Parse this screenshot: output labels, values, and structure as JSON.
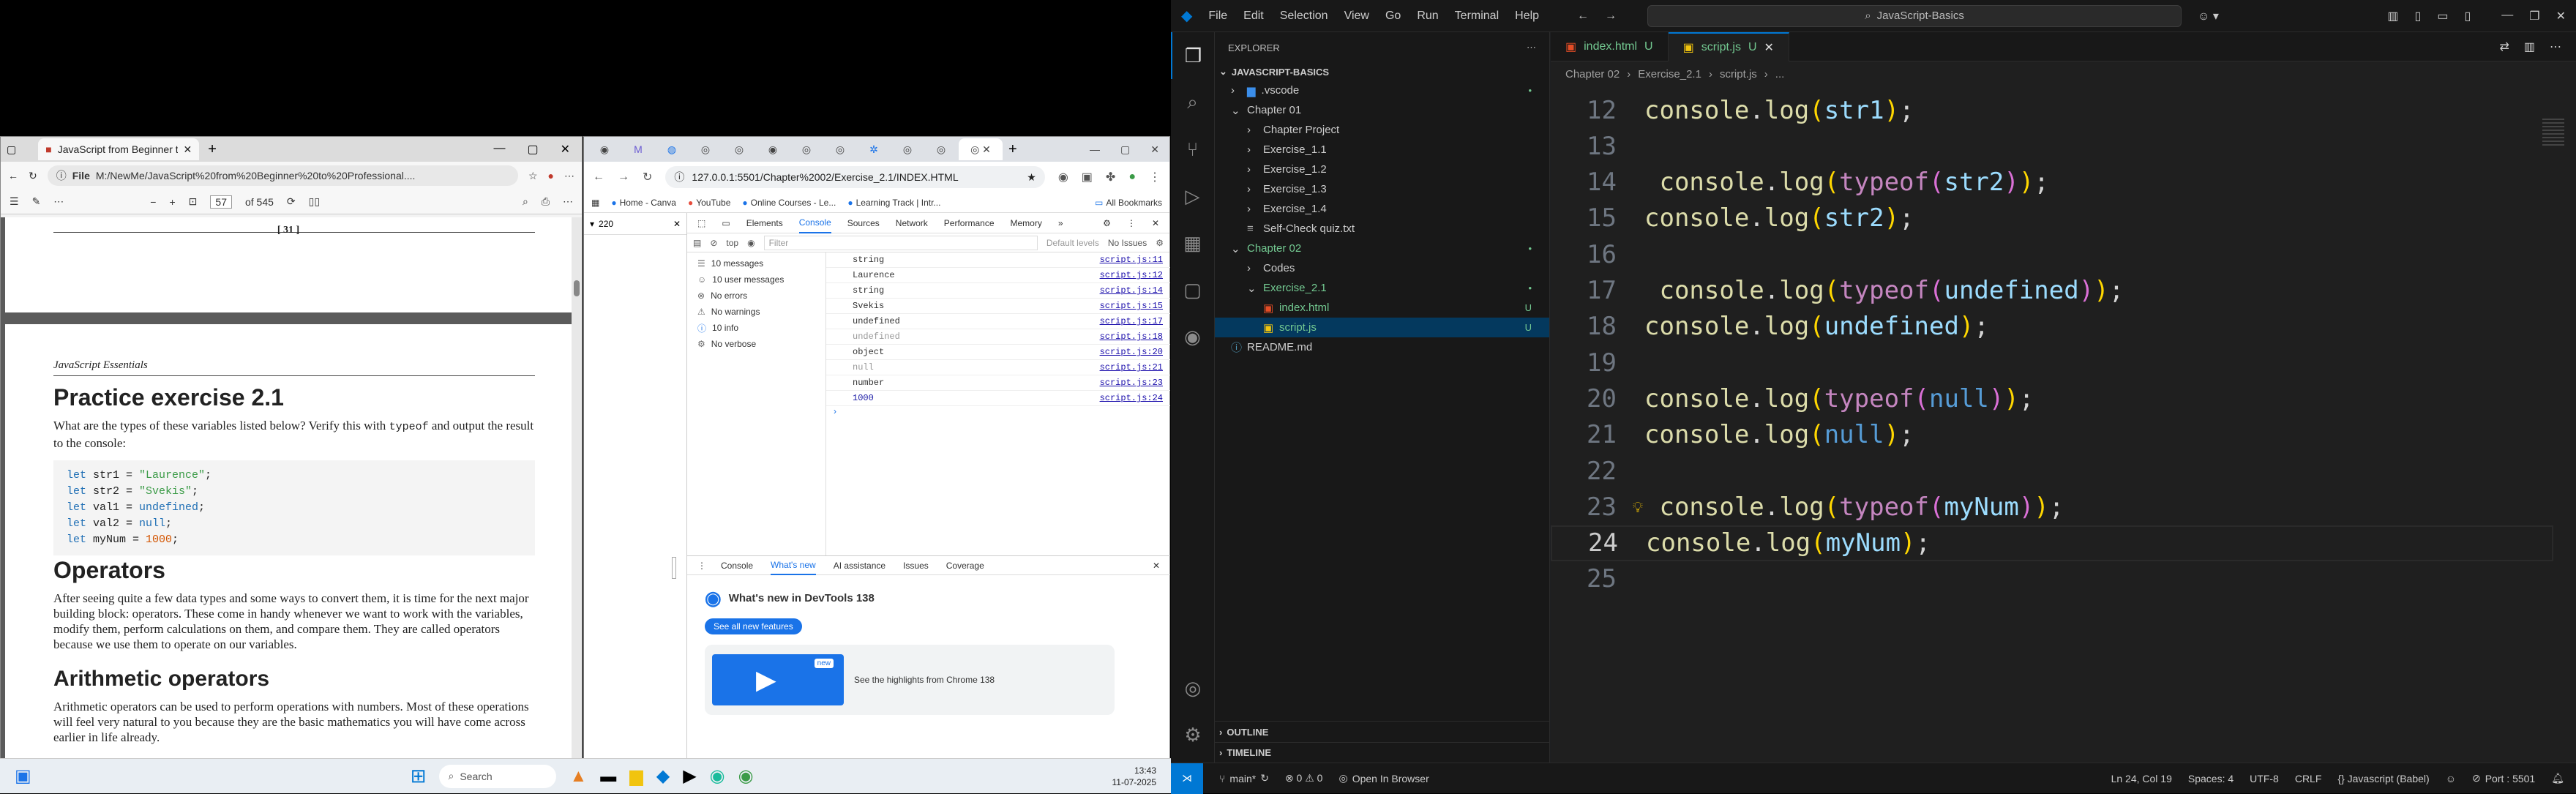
{
  "pdf": {
    "tab_title": "JavaScript from Beginner to Profe",
    "address": "M:/NewMe/JavaScript%20from%20Beginner%20to%20Professional....",
    "file_label": "File",
    "page_input": "57",
    "page_total": "of 545",
    "page_number_header": "[ 31 ]",
    "running_head": "JavaScript Essentials",
    "section1_title": "Practice exercise 2.1",
    "section1_text_a": "What are the types of these variables listed below? Verify this with",
    "section1_text_code": "typeof",
    "section1_text_b": "and",
    "section1_text_c": "output the result to the console:",
    "code_lines": [
      {
        "kw": "let",
        "name": " str1 = ",
        "val": "\"Laurence\"",
        "cls": "str"
      },
      {
        "kw": "let",
        "name": " str2 = ",
        "val": "\"Svekis\"",
        "cls": "str"
      },
      {
        "kw": "let",
        "name": " val1 = ",
        "val": "undefined",
        "cls": "kw"
      },
      {
        "kw": "let",
        "name": " val2 = ",
        "val": "null",
        "cls": "kw"
      },
      {
        "kw": "let",
        "name": " myNum = ",
        "val": "1000",
        "cls": "num"
      }
    ],
    "section2_title": "Operators",
    "section2_text": "After seeing quite a few data types and some ways to convert them, it is time for the next major building block: operators. These come in handy whenever we want to work with the variables, modify them, perform calculations on them, and compare them. They are called operators because we use them to operate on our variables.",
    "section3_title": "Arithmetic operators",
    "section3_text": "Arithmetic operators can be used to perform operations with numbers. Most of these operations will feel very natural to you because they are the basic mathematics you will have come across earlier in life already."
  },
  "chrome": {
    "url": "127.0.0.1:5501/Chapter%2002/Exercise_2.1/INDEX.HTML",
    "bookmarks": [
      "Home - Canva",
      "YouTube",
      "Online Courses - Le...",
      "Learning Track | Intr...",
      "All Bookmarks"
    ],
    "zoom_value": "220",
    "devtools_tabs": [
      "Elements",
      "Console",
      "Sources",
      "Network",
      "Performance",
      "Memory"
    ],
    "context": "top",
    "filter_placeholder": "Filter",
    "levels": "Default levels",
    "issues": "No Issues",
    "sidebar_items": [
      "10 messages",
      "10 user messages",
      "No errors",
      "No warnings",
      "10 info",
      "No verbose"
    ],
    "console_lines": [
      {
        "text": "string",
        "src": "script.js:11",
        "dim": false
      },
      {
        "text": "Laurence",
        "src": "script.js:12",
        "dim": false
      },
      {
        "text": "string",
        "src": "script.js:14",
        "dim": false
      },
      {
        "text": "Svekis",
        "src": "script.js:15",
        "dim": false
      },
      {
        "text": "undefined",
        "src": "script.js:17",
        "dim": false
      },
      {
        "text": "undefined",
        "src": "script.js:18",
        "dim": true
      },
      {
        "text": "object",
        "src": "script.js:20",
        "dim": false
      },
      {
        "text": "null",
        "src": "script.js:21",
        "dim": true
      },
      {
        "text": "number",
        "src": "script.js:23",
        "dim": false
      },
      {
        "text": "1000",
        "src": "script.js:24",
        "dim": false
      }
    ],
    "prompt": "›",
    "drawer_tabs": [
      "Console",
      "What's new",
      "AI assistance",
      "Issues",
      "Coverage"
    ],
    "whats_new_title": "What's new in DevTools 138",
    "see_all": "See all new features",
    "new_badge": "new",
    "highlights": "See the highlights from Chrome 138"
  },
  "vscode": {
    "menu": [
      "File",
      "Edit",
      "Selection",
      "View",
      "Go",
      "Run",
      "Terminal",
      "Help"
    ],
    "search": "JavaScript-Basics",
    "explorer_title": "EXPLORER",
    "root": "JAVASCRIPT-BASICS",
    "tree": [
      {
        "label": ".vscode",
        "depth": 1,
        "type": "folder",
        "open": false,
        "git": "•"
      },
      {
        "label": "Chapter 01",
        "depth": 1,
        "type": "folder",
        "open": true,
        "git": ""
      },
      {
        "label": "Chapter Project",
        "depth": 2,
        "type": "folder",
        "open": false,
        "git": ""
      },
      {
        "label": "Exercise_1.1",
        "depth": 2,
        "type": "folder",
        "open": false,
        "git": ""
      },
      {
        "label": "Exercise_1.2",
        "depth": 2,
        "type": "folder",
        "open": false,
        "git": ""
      },
      {
        "label": "Exercise_1.3",
        "depth": 2,
        "type": "folder",
        "open": false,
        "git": ""
      },
      {
        "label": "Exercise_1.4",
        "depth": 2,
        "type": "folder",
        "open": false,
        "git": ""
      },
      {
        "label": "Self-Check quiz.txt",
        "depth": 2,
        "type": "txt",
        "open": false,
        "git": ""
      },
      {
        "label": "Chapter 02",
        "depth": 1,
        "type": "folder",
        "open": true,
        "git": "•",
        "color": "#73c991"
      },
      {
        "label": "Codes",
        "depth": 2,
        "type": "folder",
        "open": false,
        "git": ""
      },
      {
        "label": "Exercise_2.1",
        "depth": 2,
        "type": "folder",
        "open": true,
        "git": "•",
        "color": "#73c991"
      },
      {
        "label": "index.html",
        "depth": 3,
        "type": "html",
        "open": false,
        "git": "U",
        "color": "#73c991"
      },
      {
        "label": "script.js",
        "depth": 3,
        "type": "js",
        "open": false,
        "git": "U",
        "color": "#73c991"
      },
      {
        "label": "README.md",
        "depth": 1,
        "type": "md",
        "open": false,
        "git": ""
      }
    ],
    "outline": "OUTLINE",
    "timeline": "TIMELINE",
    "tabs": [
      {
        "label": "index.html",
        "badge": "U",
        "active": false
      },
      {
        "label": "script.js",
        "badge": "U",
        "active": true
      }
    ],
    "breadcrumbs": [
      "Chapter 02",
      "Exercise_2.1",
      "script.js",
      "..."
    ],
    "code": [
      {
        "n": "12",
        "parts": [
          [
            "fn",
            "console"
          ],
          [
            "cc",
            "."
          ],
          [
            "fn",
            "log"
          ],
          [
            "p1",
            "("
          ],
          [
            "v",
            "str1"
          ],
          [
            "p1",
            ")"
          ],
          [
            "cc",
            ";"
          ]
        ]
      },
      {
        "n": "13",
        "parts": []
      },
      {
        "n": "14",
        "parts": [
          [
            "cc",
            " "
          ],
          [
            "fn",
            "console"
          ],
          [
            "cc",
            "."
          ],
          [
            "fn",
            "log"
          ],
          [
            "p1",
            "("
          ],
          [
            "ty",
            "typeof"
          ],
          [
            "p2",
            "("
          ],
          [
            "v",
            "str2"
          ],
          [
            "p2",
            ")"
          ],
          [
            "p1",
            ")"
          ],
          [
            "cc",
            ";"
          ]
        ]
      },
      {
        "n": "15",
        "parts": [
          [
            "fn",
            "console"
          ],
          [
            "cc",
            "."
          ],
          [
            "fn",
            "log"
          ],
          [
            "p1",
            "("
          ],
          [
            "v",
            "str2"
          ],
          [
            "p1",
            ")"
          ],
          [
            "cc",
            ";"
          ]
        ]
      },
      {
        "n": "16",
        "parts": []
      },
      {
        "n": "17",
        "parts": [
          [
            "cc",
            " "
          ],
          [
            "fn",
            "console"
          ],
          [
            "cc",
            "."
          ],
          [
            "fn",
            "log"
          ],
          [
            "p1",
            "("
          ],
          [
            "ty",
            "typeof"
          ],
          [
            "p2",
            "("
          ],
          [
            "v",
            "undefined"
          ],
          [
            "p2",
            ")"
          ],
          [
            "p1",
            ")"
          ],
          [
            "cc",
            ";"
          ]
        ]
      },
      {
        "n": "18",
        "parts": [
          [
            "fn",
            "console"
          ],
          [
            "cc",
            "."
          ],
          [
            "fn",
            "log"
          ],
          [
            "p1",
            "("
          ],
          [
            "v",
            "undefined"
          ],
          [
            "p1",
            ")"
          ],
          [
            "cc",
            ";"
          ]
        ]
      },
      {
        "n": "19",
        "parts": []
      },
      {
        "n": "20",
        "parts": [
          [
            "fn",
            "console"
          ],
          [
            "cc",
            "."
          ],
          [
            "fn",
            "log"
          ],
          [
            "p1",
            "("
          ],
          [
            "ty",
            "typeof"
          ],
          [
            "p2",
            "("
          ],
          [
            "k",
            "null"
          ],
          [
            "p2",
            ")"
          ],
          [
            "p1",
            ")"
          ],
          [
            "cc",
            ";"
          ]
        ]
      },
      {
        "n": "21",
        "parts": [
          [
            "fn",
            "console"
          ],
          [
            "cc",
            "."
          ],
          [
            "fn",
            "log"
          ],
          [
            "p1",
            "("
          ],
          [
            "k",
            "null"
          ],
          [
            "p1",
            ")"
          ],
          [
            "cc",
            ";"
          ]
        ]
      },
      {
        "n": "22",
        "parts": []
      },
      {
        "n": "23",
        "parts": [
          [
            "cc",
            " "
          ],
          [
            "fn",
            "console"
          ],
          [
            "cc",
            "."
          ],
          [
            "fn",
            "log"
          ],
          [
            "p1",
            "("
          ],
          [
            "ty",
            "typeof"
          ],
          [
            "p2",
            "("
          ],
          [
            "v",
            "myNum"
          ],
          [
            "p2",
            ")"
          ],
          [
            "p1",
            ")"
          ],
          [
            "cc",
            ";"
          ]
        ]
      },
      {
        "n": "24",
        "parts": [
          [
            "fn",
            "console"
          ],
          [
            "cc",
            "."
          ],
          [
            "fn",
            "log"
          ],
          [
            "p1",
            "("
          ],
          [
            "v",
            "myNum"
          ],
          [
            "p1",
            ")"
          ],
          [
            "cc",
            ";"
          ]
        ],
        "current": true
      },
      {
        "n": "25",
        "parts": []
      }
    ],
    "status": {
      "branch": "main*",
      "problems": "⊗ 0 ⚠ 0",
      "open_browser": "Open In Browser",
      "position": "Ln 24, Col 19",
      "spaces": "Spaces: 4",
      "encoding": "UTF-8",
      "eol": "CRLF",
      "language": "{} Javascript (Babel)",
      "port": "Port : 5501"
    }
  },
  "taskbar": {
    "search": "Search",
    "time": "13:43",
    "date": "11-07-2025"
  },
  "colors": {
    "vs_blue": "#0078d4",
    "git_green": "#73c991",
    "chrome_blue": "#1a73e8"
  }
}
